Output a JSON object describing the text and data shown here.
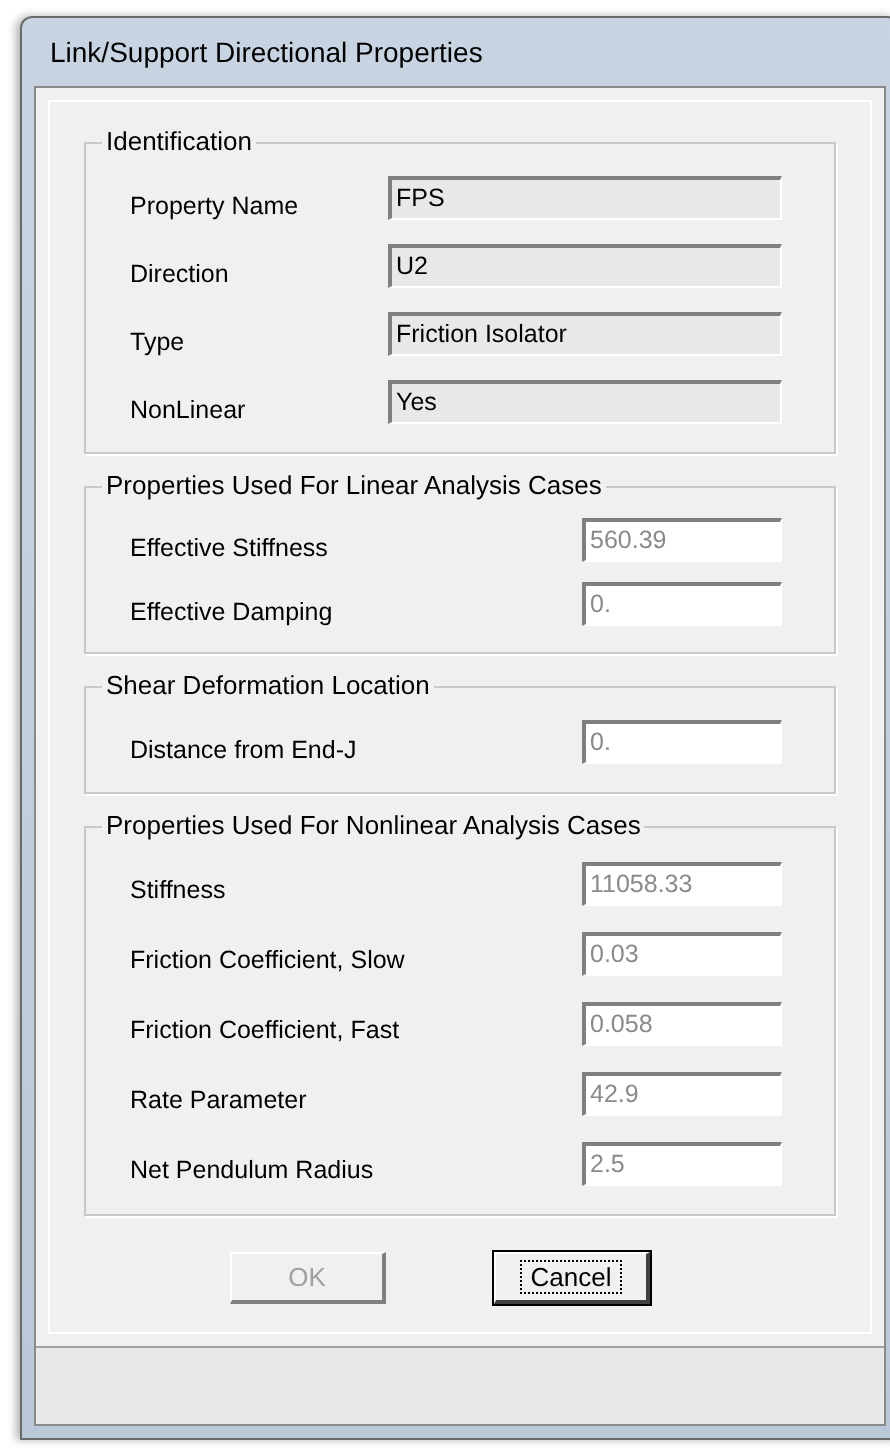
{
  "window": {
    "title": "Link/Support Directional Properties"
  },
  "groups": [
    {
      "title": "Identification",
      "fields": [
        {
          "label": "Property Name",
          "value": "FPS",
          "kind": "readonly"
        },
        {
          "label": "Direction",
          "value": "U2",
          "kind": "readonly"
        },
        {
          "label": "Type",
          "value": "Friction Isolator",
          "kind": "readonly"
        },
        {
          "label": "NonLinear",
          "value": "Yes",
          "kind": "readonly"
        }
      ]
    },
    {
      "title": "Properties Used For Linear Analysis Cases",
      "fields": [
        {
          "label": "Effective Stiffness",
          "value": "560.39",
          "kind": "disabled"
        },
        {
          "label": "Effective Damping",
          "value": "0.",
          "kind": "disabled"
        }
      ]
    },
    {
      "title": "Shear Deformation Location",
      "fields": [
        {
          "label": "Distance from End-J",
          "value": "0.",
          "kind": "disabled"
        }
      ]
    },
    {
      "title": "Properties Used For Nonlinear Analysis Cases",
      "fields": [
        {
          "label": "Stiffness",
          "value": "11058.33",
          "kind": "disabled"
        },
        {
          "label": "Friction Coefficient, Slow",
          "value": "0.03",
          "kind": "disabled"
        },
        {
          "label": "Friction Coefficient, Fast",
          "value": "0.058",
          "kind": "disabled"
        },
        {
          "label": "Rate Parameter",
          "value": "42.9",
          "kind": "disabled"
        },
        {
          "label": "Net Pendulum Radius",
          "value": "2.5",
          "kind": "disabled"
        }
      ]
    }
  ],
  "buttons": [
    {
      "label": "OK",
      "disabled": true,
      "focused": false
    },
    {
      "label": "Cancel",
      "disabled": false,
      "focused": true
    }
  ]
}
